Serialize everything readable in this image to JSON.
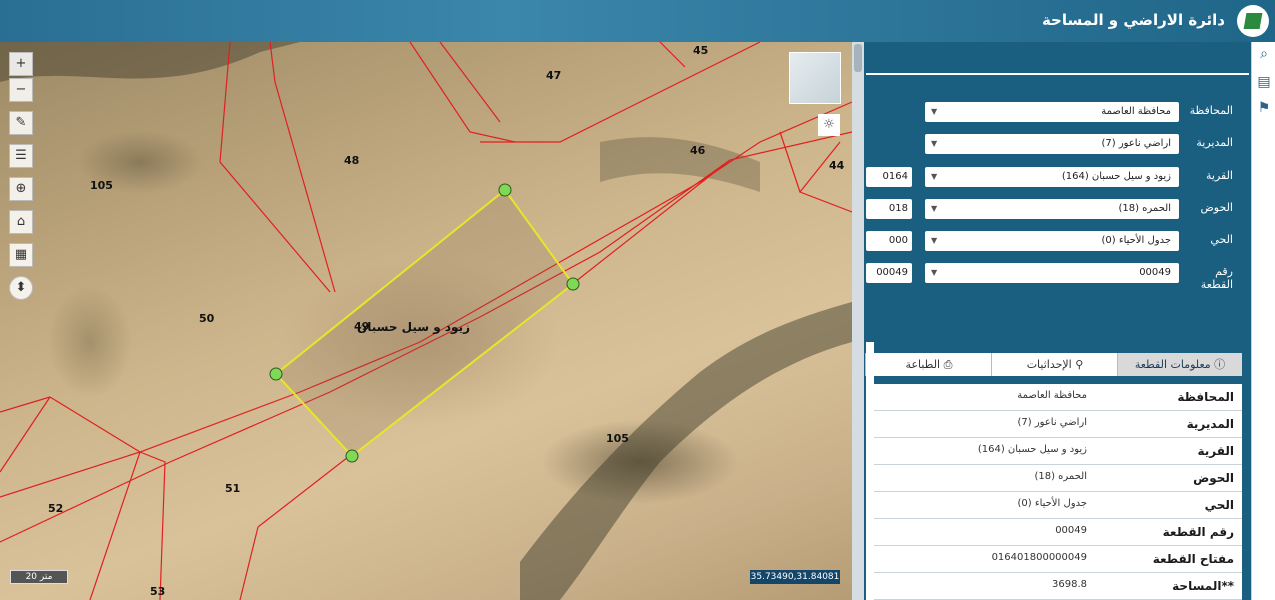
{
  "header": {
    "title": "دائرة الاراضي و المساحة"
  },
  "map": {
    "parcel_label": "زيود و سيل حسبان",
    "parcel_numbers": [
      "45",
      "47",
      "46",
      "44",
      "48",
      "105",
      "50",
      "49",
      "105",
      "51",
      "52",
      "53"
    ],
    "scale_label": "20 متر",
    "coordinates": "35.73490,31.84081"
  },
  "tools": {
    "zoom_in": "+",
    "zoom_out": "−",
    "draw": "✎",
    "measure": "☰",
    "locate": "⊕",
    "home": "⌂",
    "chart": "▦",
    "compass": "⬍",
    "sun": "☼"
  },
  "form": {
    "rows": [
      {
        "label": "المحافظة",
        "value": "محافظة العاصمة",
        "code": ""
      },
      {
        "label": "المديرية",
        "value": "اراضي ناعور (7)",
        "code": ""
      },
      {
        "label": "القرية",
        "value": "زيود و سيل حسبان (164)",
        "code": "0164"
      },
      {
        "label": "الحوض",
        "value": "الحمره (18)",
        "code": "018"
      },
      {
        "label": "الحي",
        "value": "جدول الأحياء (0)",
        "code": "000"
      },
      {
        "label": "رقم القطعة",
        "value": "00049",
        "code": "00049"
      }
    ]
  },
  "tabs": [
    {
      "label": "معلومات القطعة",
      "icon": "info-icon"
    },
    {
      "label": "الإحداثيات",
      "icon": "person-icon"
    },
    {
      "label": "الطباعة",
      "icon": "print-icon"
    }
  ],
  "info": [
    {
      "key": "المحافظة",
      "value": "محافظة العاصمة"
    },
    {
      "key": "المديرية",
      "value": "اراضي ناعور (7)"
    },
    {
      "key": "القرية",
      "value": "زيود و سيل حسبان (164)"
    },
    {
      "key": "الحوض",
      "value": "الحمره (18)"
    },
    {
      "key": "الحي",
      "value": "جدول الأحياء (0)"
    },
    {
      "key": "رقم القطعة",
      "value": "00049"
    },
    {
      "key": "مفتاح القطعة",
      "value": "016401800000049"
    },
    {
      "key": "**المساحة",
      "value": "3698.8"
    }
  ],
  "colors": {
    "header": "#2d7599",
    "panel": "#1a5e80",
    "parcel_outline": "#e6e62a",
    "boundaries": "#e02020",
    "vertex": "#7ed957"
  }
}
